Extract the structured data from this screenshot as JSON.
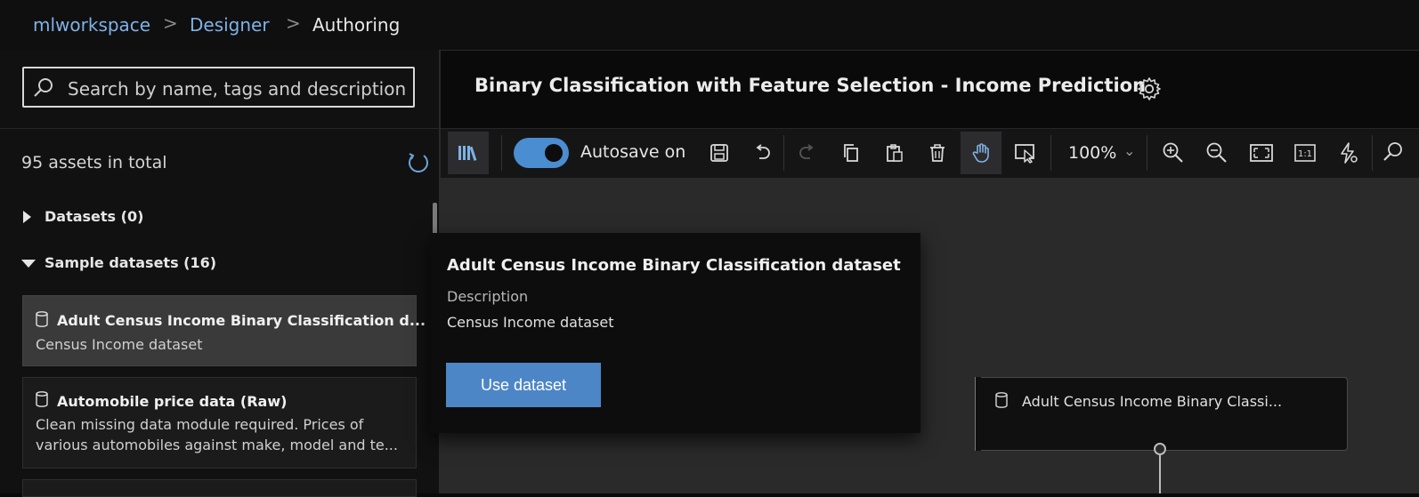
{
  "breadcrumb": {
    "items": [
      "mlworkspace",
      "Designer",
      "Authoring"
    ],
    "separator": ">"
  },
  "search": {
    "placeholder": "Search by name, tags and description"
  },
  "assets": {
    "count_text": "95 assets in total",
    "groups": [
      {
        "label": "Datasets (0)",
        "expanded": false
      },
      {
        "label": "Sample datasets (16)",
        "expanded": true
      }
    ],
    "items": [
      {
        "title": "Adult Census Income Binary Classification d...",
        "desc": "Census Income dataset",
        "selected": true
      },
      {
        "title": "Automobile price data (Raw)",
        "desc": "Clean missing data module required. Prices of various automobiles against make, model and te...",
        "selected": false
      }
    ]
  },
  "header": {
    "title": "Binary Classification with Feature Selection - Income Prediction"
  },
  "toolbar": {
    "autosave_label": "Autosave on",
    "autosave_on": true,
    "zoom_label": "100%",
    "zoom_caret": "⌄"
  },
  "popup": {
    "title": "Adult Census Income Binary Classification dataset",
    "desc_label": "Description",
    "desc": "Census Income dataset",
    "button": "Use dataset"
  },
  "canvas_node": {
    "title": "Adult Census Income Binary Classi..."
  },
  "colors": {
    "accent": "#4a8dd1",
    "link": "#7fb2e5",
    "button": "#4d86c7"
  }
}
